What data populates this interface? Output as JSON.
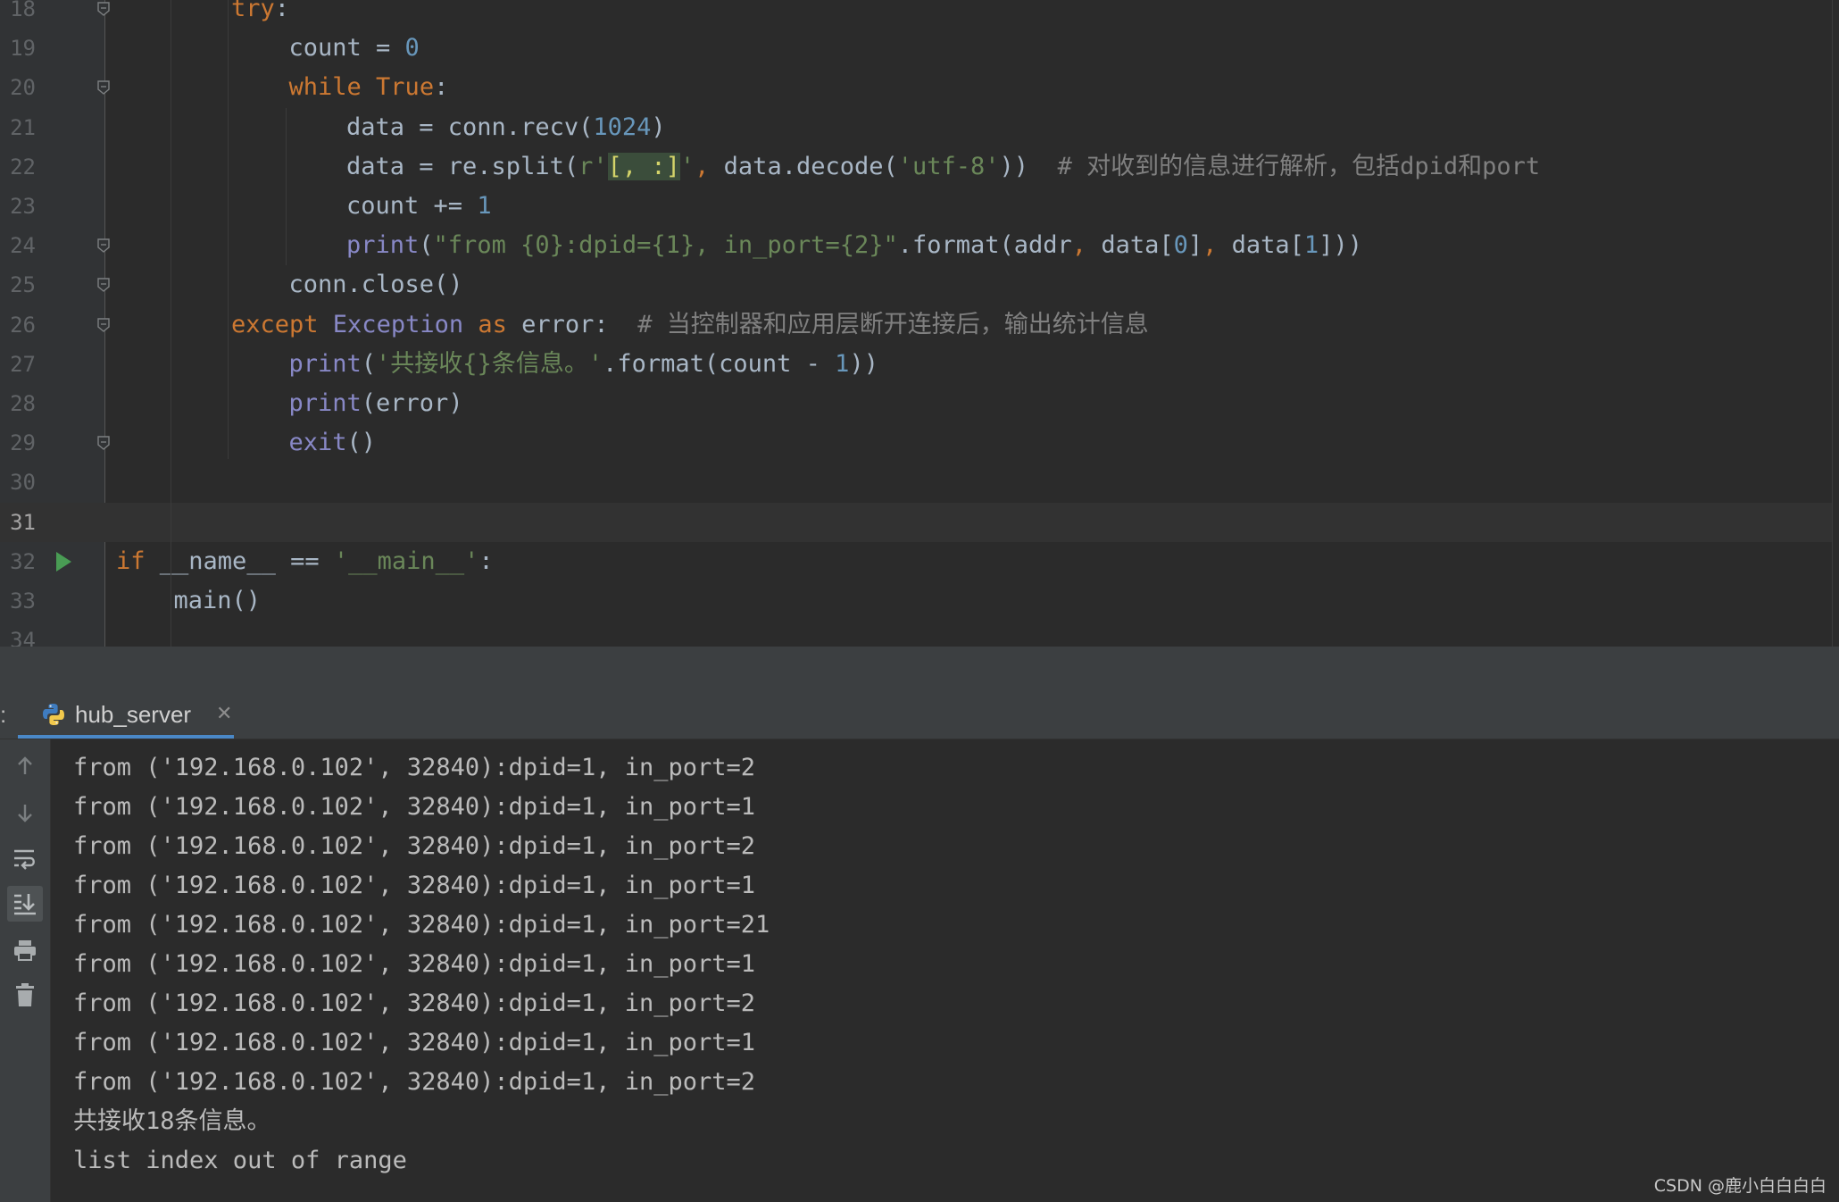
{
  "editor": {
    "lines": [
      {
        "n": "18",
        "indent": 2,
        "tokens": [
          [
            "kw",
            "try"
          ],
          [
            "",
            "​:"
          ]
        ]
      },
      {
        "n": "19",
        "indent": 3,
        "tokens": [
          [
            "",
            "count = "
          ],
          [
            "num",
            "0"
          ]
        ]
      },
      {
        "n": "20",
        "indent": 3,
        "tokens": [
          [
            "kw",
            "while "
          ],
          [
            "kw",
            "True"
          ],
          [
            "",
            ":"
          ]
        ]
      },
      {
        "n": "21",
        "indent": 4,
        "tokens": [
          [
            "",
            "data = conn.recv("
          ],
          [
            "num",
            "1024"
          ],
          [
            "",
            ")"
          ]
        ]
      },
      {
        "n": "22",
        "indent": 4,
        "tokens": [
          [
            "",
            "data = re.split("
          ],
          [
            "str",
            "r'"
          ],
          [
            "hlbr",
            "[, :]"
          ],
          [
            "str",
            "'"
          ],
          [
            "kw",
            ", "
          ],
          [
            "",
            "data.decode("
          ],
          [
            "str",
            "'utf-8'"
          ],
          [
            "",
            "))  "
          ],
          [
            "cmt",
            "# 对收到的信息进行解析，包括dpid和port"
          ]
        ]
      },
      {
        "n": "23",
        "indent": 4,
        "tokens": [
          [
            "",
            "count += "
          ],
          [
            "num",
            "1"
          ]
        ]
      },
      {
        "n": "24",
        "indent": 4,
        "tokens": [
          [
            "bi",
            "print"
          ],
          [
            "",
            "("
          ],
          [
            "str",
            "\"from {0}:dpid={1}, in_port={2}\""
          ],
          [
            "",
            ".format(addr"
          ],
          [
            "kw",
            ", "
          ],
          [
            "",
            "data["
          ],
          [
            "num",
            "0"
          ],
          [
            "",
            "]"
          ],
          [
            "kw",
            ", "
          ],
          [
            "",
            "data["
          ],
          [
            "num",
            "1"
          ],
          [
            "",
            "]))"
          ]
        ]
      },
      {
        "n": "25",
        "indent": 3,
        "tokens": [
          [
            "",
            "conn.close()"
          ]
        ]
      },
      {
        "n": "26",
        "indent": 2,
        "tokens": [
          [
            "kw",
            "except "
          ],
          [
            "bi",
            "Exception "
          ],
          [
            "kw",
            "as "
          ],
          [
            "",
            "error:  "
          ],
          [
            "cmt",
            "# 当控制器和应用层断开连接后，输出统计信息"
          ]
        ]
      },
      {
        "n": "27",
        "indent": 3,
        "tokens": [
          [
            "bi",
            "print"
          ],
          [
            "",
            "("
          ],
          [
            "str",
            "'共接收{}条信息。'"
          ],
          [
            "",
            ".format(count - "
          ],
          [
            "num",
            "1"
          ],
          [
            "",
            "))"
          ]
        ]
      },
      {
        "n": "28",
        "indent": 3,
        "tokens": [
          [
            "bi",
            "print"
          ],
          [
            "",
            "(error)"
          ]
        ]
      },
      {
        "n": "29",
        "indent": 3,
        "tokens": [
          [
            "bi",
            "exit"
          ],
          [
            "",
            "()"
          ]
        ]
      },
      {
        "n": "30",
        "indent": 0,
        "tokens": []
      },
      {
        "n": "31",
        "indent": 0,
        "tokens": [],
        "current": true
      },
      {
        "n": "32",
        "indent": 0,
        "tokens": [
          [
            "kw",
            "if "
          ],
          [
            "",
            "__name__ == "
          ],
          [
            "str",
            "'__main__'"
          ],
          [
            "",
            ":"
          ]
        ],
        "run": true
      },
      {
        "n": "33",
        "indent": 1,
        "tokens": [
          [
            "",
            "main()"
          ]
        ]
      },
      {
        "n": "34",
        "indent": 0,
        "tokens": []
      }
    ],
    "folds": [
      "18",
      "20",
      "24",
      "25",
      "26",
      "29"
    ]
  },
  "run_panel": {
    "prefix": ":",
    "tab_label": "hub_server",
    "tab_close": "✕"
  },
  "console": {
    "lines": [
      "from ('192.168.0.102', 32840):dpid=1, in_port=2",
      "from ('192.168.0.102', 32840):dpid=1, in_port=1",
      "from ('192.168.0.102', 32840):dpid=1, in_port=2",
      "from ('192.168.0.102', 32840):dpid=1, in_port=1",
      "from ('192.168.0.102', 32840):dpid=1, in_port=21",
      "from ('192.168.0.102', 32840):dpid=1, in_port=1",
      "from ('192.168.0.102', 32840):dpid=1, in_port=2",
      "from ('192.168.0.102', 32840):dpid=1, in_port=1",
      "from ('192.168.0.102', 32840):dpid=1, in_port=2",
      "共接收18条信息。",
      "list index out of range"
    ],
    "toolbar": [
      "arrow-up-icon",
      "arrow-down-icon",
      "soft-wrap-icon",
      "scroll-to-end-icon",
      "print-icon",
      "trash-icon"
    ]
  },
  "watermark": "CSDN @鹿小白白白白"
}
